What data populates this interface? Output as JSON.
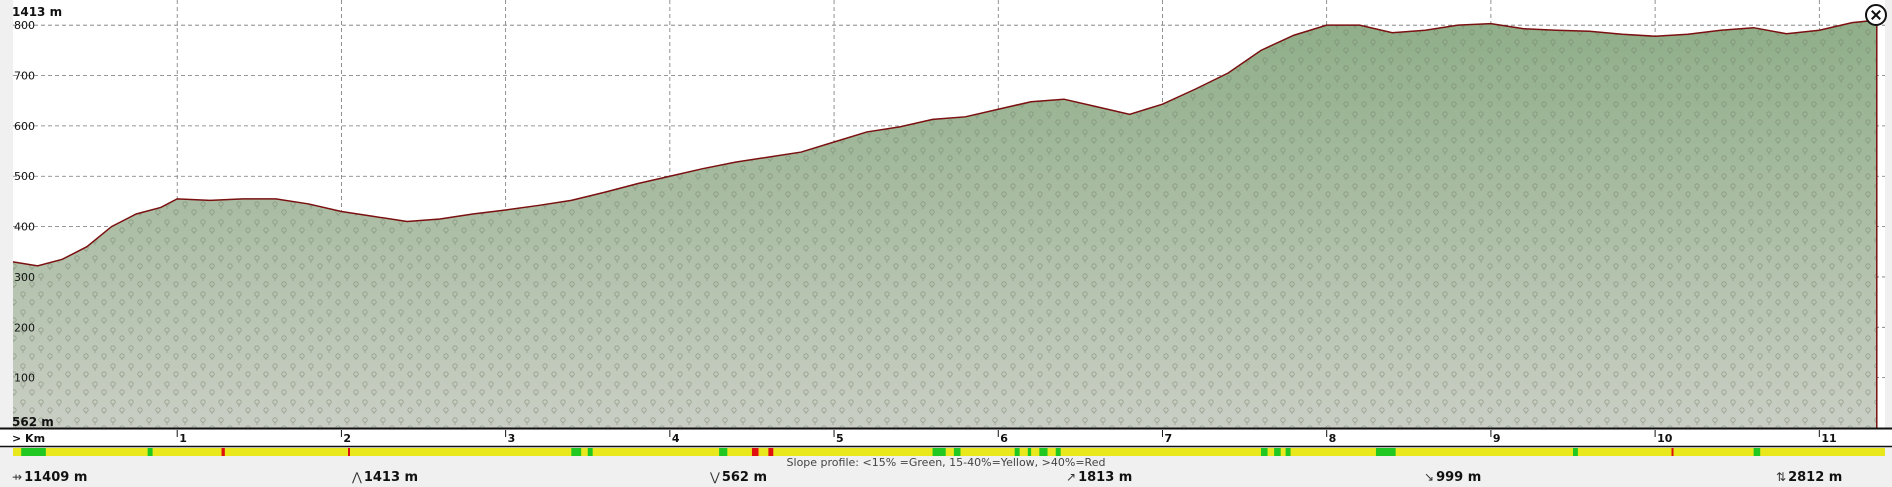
{
  "chart_data": {
    "type": "area",
    "title": "",
    "xlabel": "> Km",
    "ylabel": "",
    "max_label": "1413 m",
    "min_label": "562 m",
    "ylim": [
      0,
      850
    ],
    "xlim": [
      0,
      11.4
    ],
    "y_ticks": [
      100,
      200,
      300,
      400,
      500,
      600,
      700,
      800
    ],
    "x_ticks": [
      1,
      2,
      3,
      4,
      5,
      6,
      7,
      8,
      9,
      10,
      11
    ],
    "grid": true,
    "x": [
      0,
      0.15,
      0.3,
      0.45,
      0.6,
      0.75,
      0.9,
      1.0,
      1.2,
      1.4,
      1.6,
      1.8,
      2.0,
      2.2,
      2.4,
      2.6,
      2.8,
      3.0,
      3.2,
      3.4,
      3.6,
      3.8,
      4.0,
      4.2,
      4.4,
      4.6,
      4.8,
      5.0,
      5.2,
      5.4,
      5.6,
      5.8,
      6.0,
      6.2,
      6.4,
      6.6,
      6.8,
      7.0,
      7.2,
      7.4,
      7.6,
      7.8,
      8.0,
      8.2,
      8.4,
      8.6,
      8.8,
      9.0,
      9.2,
      9.4,
      9.6,
      9.8,
      10.0,
      10.2,
      10.4,
      10.6,
      10.8,
      11.0,
      11.2,
      11.35
    ],
    "y": [
      330,
      322,
      335,
      360,
      400,
      425,
      438,
      455,
      452,
      455,
      455,
      445,
      430,
      420,
      410,
      415,
      425,
      433,
      442,
      452,
      468,
      485,
      500,
      515,
      528,
      538,
      548,
      568,
      588,
      598,
      613,
      618,
      633,
      648,
      653,
      638,
      623,
      643,
      673,
      705,
      750,
      780,
      800,
      800,
      785,
      790,
      800,
      803,
      793,
      790,
      788,
      782,
      778,
      782,
      790,
      795,
      783,
      790,
      805,
      810
    ]
  },
  "slope_bar": {
    "legend": "Slope profile: <15% =Green, 15-40%=Yellow, >40%=Red",
    "base_color": "#e8e81c",
    "green": "#22c822",
    "red": "#e01010",
    "green_segments": [
      [
        0.05,
        0.2
      ],
      [
        0.82,
        0.85
      ],
      [
        3.4,
        3.46
      ],
      [
        3.5,
        3.53
      ],
      [
        4.3,
        4.35
      ],
      [
        5.6,
        5.68
      ],
      [
        5.73,
        5.77
      ],
      [
        6.1,
        6.13
      ],
      [
        6.18,
        6.2
      ],
      [
        6.25,
        6.3
      ],
      [
        6.35,
        6.38
      ],
      [
        7.6,
        7.64
      ],
      [
        7.68,
        7.72
      ],
      [
        7.75,
        7.78
      ],
      [
        8.3,
        8.42
      ],
      [
        9.5,
        9.53
      ],
      [
        10.6,
        10.64
      ]
    ],
    "red_segments": [
      [
        1.27,
        1.29
      ],
      [
        2.04,
        2.05
      ],
      [
        4.5,
        4.54
      ],
      [
        4.6,
        4.63
      ],
      [
        10.1,
        10.11
      ]
    ]
  },
  "footer": {
    "distance": "11409 m",
    "max_elevation": "1413 m",
    "min_elevation": "562 m",
    "ascent": "1813 m",
    "descent": "999 m",
    "total": "2812 m"
  },
  "colors": {
    "fill_top": "#8fae88",
    "fill_bottom": "#c9cec4",
    "outline": "#7a1010",
    "grid": "#777777"
  },
  "icons": {
    "close": "close-icon",
    "distance": "distance-icon",
    "peak": "peak-icon",
    "valley": "valley-icon"
  }
}
